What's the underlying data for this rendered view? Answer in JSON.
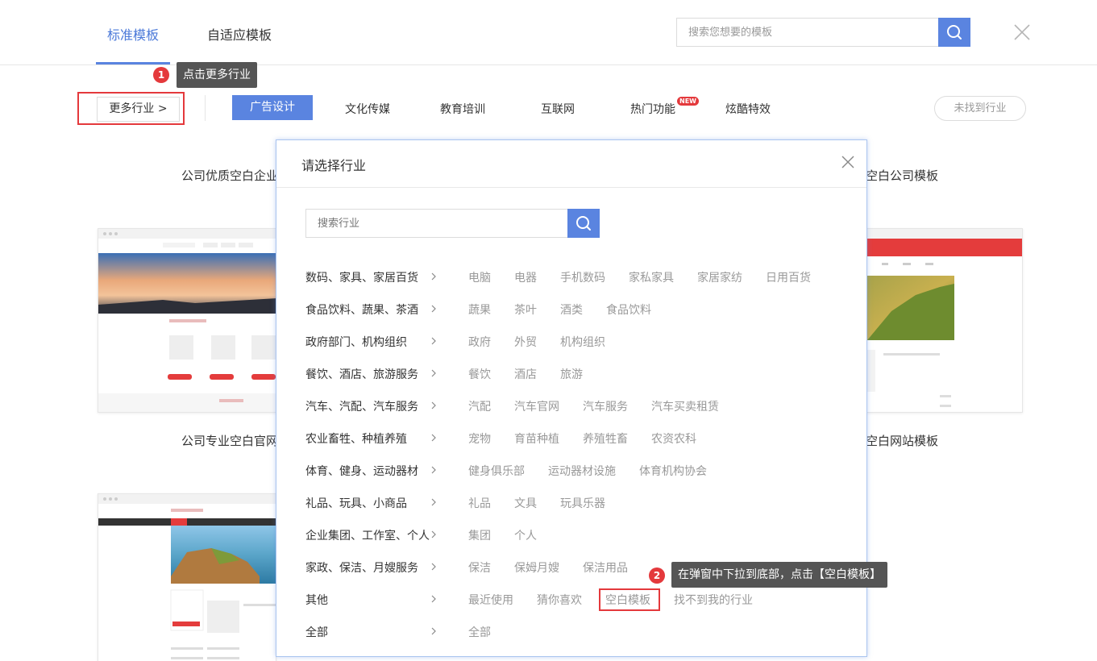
{
  "header": {
    "tabs": [
      {
        "label": "标准模板",
        "active": true
      },
      {
        "label": "自适应模板",
        "active": false
      }
    ],
    "search_placeholder": "搜索您想要的模板",
    "icons": {
      "search": "search-icon",
      "close": "close-icon"
    }
  },
  "steps": {
    "step1": {
      "number": "1",
      "text": "点击更多行业"
    },
    "step2": {
      "number": "2",
      "text": "在弹窗中下拉到底部，点击【空白模板】"
    }
  },
  "categories": {
    "more_label": "更多行业 >",
    "items": [
      "广告设计",
      "文化传媒",
      "教育培训",
      "互联网",
      "热门功能",
      "炫酷特效"
    ],
    "active": "广告设计",
    "new_badge": "NEW",
    "not_found_label": "未找到行业"
  },
  "templates": {
    "row1_left_title": "公司优质空白企业",
    "row1_right_title": "空白公司模板",
    "row2_left_title": "公司专业空白官网",
    "row2_right_title": "空白网站模板"
  },
  "modal": {
    "title": "请选择行业",
    "search_placeholder": "搜索行业",
    "industries": [
      {
        "name": "数码、家具、家居百货",
        "tags": [
          "电脑",
          "电器",
          "手机数码",
          "家私家具",
          "家居家纺",
          "日用百货"
        ]
      },
      {
        "name": "食品饮料、蔬果、茶酒",
        "tags": [
          "蔬果",
          "茶叶",
          "酒类",
          "食品饮料"
        ]
      },
      {
        "name": "政府部门、机构组织",
        "tags": [
          "政府",
          "外贸",
          "机构组织"
        ]
      },
      {
        "name": "餐饮、酒店、旅游服务",
        "tags": [
          "餐饮",
          "酒店",
          "旅游"
        ]
      },
      {
        "name": "汽车、汽配、汽车服务",
        "tags": [
          "汽配",
          "汽车官网",
          "汽车服务",
          "汽车买卖租赁"
        ]
      },
      {
        "name": "农业畜牲、种植养殖",
        "tags": [
          "宠物",
          "育苗种植",
          "养殖牲畜",
          "农资农科"
        ]
      },
      {
        "name": "体育、健身、运动器材",
        "tags": [
          "健身俱乐部",
          "运动器材设施",
          "体育机构协会"
        ]
      },
      {
        "name": "礼品、玩具、小商品",
        "tags": [
          "礼品",
          "文具",
          "玩具乐器"
        ]
      },
      {
        "name": "企业集团、工作室、个人",
        "tags": [
          "集团",
          "个人"
        ]
      },
      {
        "name": "家政、保洁、月嫂服务",
        "tags": [
          "保洁",
          "保姆月嫂",
          "保洁用品"
        ]
      },
      {
        "name": "其他",
        "tags": [
          "最近使用",
          "猜你喜欢",
          "空白模板",
          "找不到我的行业"
        ]
      },
      {
        "name": "全部",
        "tags": [
          "全部"
        ]
      }
    ]
  },
  "colors": {
    "accent": "#5a84e0",
    "highlight": "#e4393c"
  }
}
